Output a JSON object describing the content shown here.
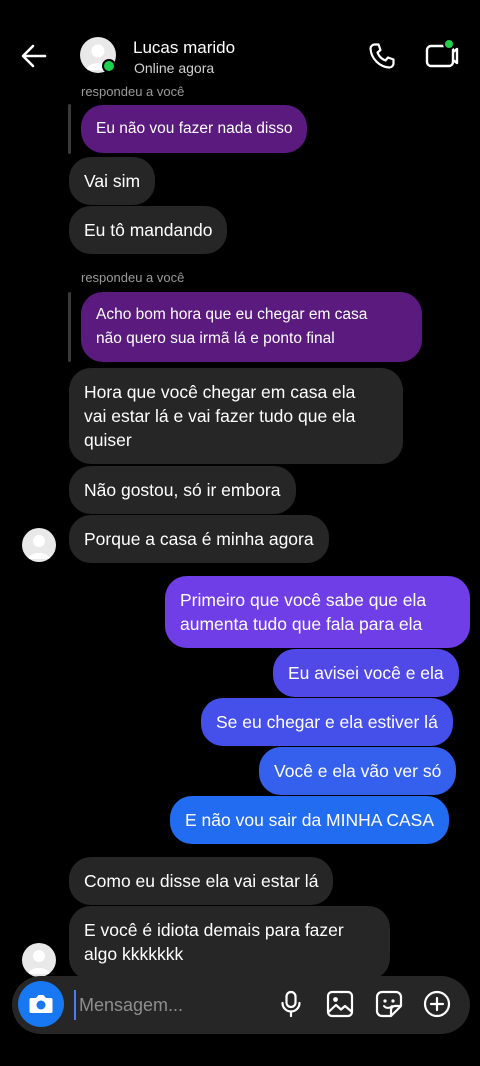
{
  "header": {
    "contact_name": "Lucas marido",
    "status": "Online agora"
  },
  "thread": {
    "reply_label_1": "respondeu a você",
    "quote_1": "Eu não vou fazer nada disso",
    "in_1": "Vai sim",
    "in_2": "Eu tô mandando",
    "reply_label_2": "respondeu a você",
    "quote_2_line1": "Acho bom hora que eu chegar em casa",
    "quote_2_line2": "não quero sua irmã lá e ponto final",
    "in_3_line1": "Hora que você chegar em casa ela",
    "in_3_line2": "vai estar lá e vai fazer tudo que ela",
    "in_3_line3": "quiser",
    "in_4": "Não gostou, só ir embora",
    "in_5": "Porque a casa é minha agora",
    "out_1_line1": "Primeiro que você sabe que ela",
    "out_1_line2": "aumenta tudo que fala para ela",
    "out_2": "Eu avisei você e ela",
    "out_3": "Se eu chegar e ela estiver lá",
    "out_4": "Você e ela vão ver só",
    "out_5": "E não vou sair da MINHA CASA",
    "in_6": "Como eu disse ela vai estar lá",
    "in_7_line1": "E você é idiota demais para fazer",
    "in_7_line2": "algo kkkkkkk"
  },
  "composer": {
    "placeholder": "Mensagem..."
  },
  "icons": {
    "back": "arrow-left-icon",
    "call": "phone-icon",
    "video": "video-camera-icon",
    "camera": "camera-icon",
    "mic": "microphone-icon",
    "gallery": "image-icon",
    "sticker": "sticker-icon",
    "add": "plus-circle-icon"
  },
  "colors": {
    "incoming": "#262626",
    "quote": "#5a1a7e",
    "outgoing_top": "#7b3fe4",
    "outgoing_bottom": "#1f6ff0",
    "online": "#1fd14f",
    "camera_button": "#1877f2"
  }
}
